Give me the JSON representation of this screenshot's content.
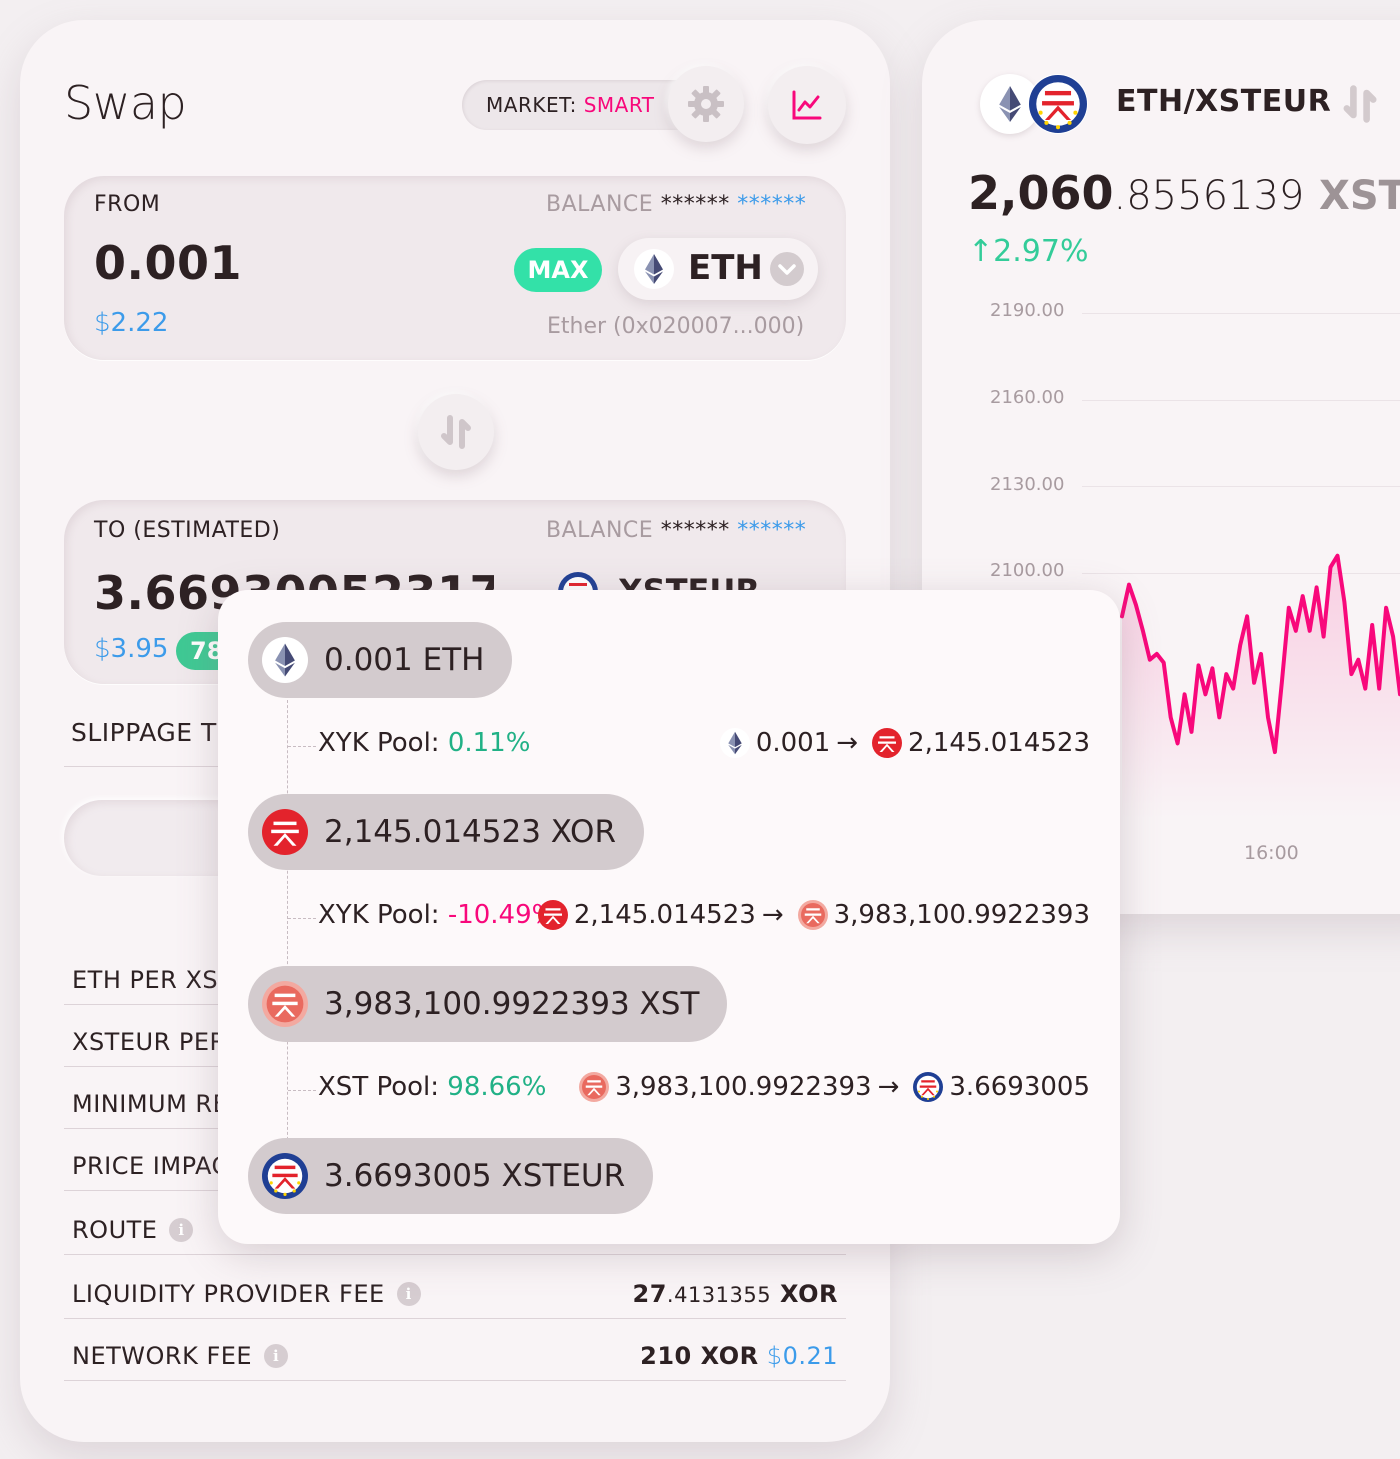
{
  "swap": {
    "title": "Swap",
    "market_label": "MARKET: ",
    "market_value": "SMART",
    "from": {
      "label": "FROM",
      "balance_label": "BALANCE",
      "balance_hidden": "******",
      "balance_hidden_usd": "******",
      "amount": "0.001",
      "usd_symbol": "$",
      "usd_value": "2.22",
      "max_label": "MAX",
      "token": "ETH",
      "token_address": "Ether (0x020007...000)"
    },
    "to": {
      "label": "TO (ESTIMATED)",
      "balance_label": "BALANCE",
      "balance_hidden": "******",
      "balance_hidden_usd": "******",
      "amount": "3.669300523174",
      "usd_symbol": "$",
      "usd_value": "3.95",
      "badge": "78",
      "token": "XSTEUR"
    },
    "slippage_label": "SLIPPAGE T",
    "rows": [
      {
        "label": "ETH PER XST",
        "value": ""
      },
      {
        "label": "XSTEUR PER",
        "value": ""
      },
      {
        "label": "MINIMUM RE",
        "value": ""
      },
      {
        "label": "PRICE IMPAC",
        "value": ""
      },
      {
        "label": "ROUTE",
        "value": ""
      }
    ],
    "lp_fee": {
      "label": "LIQUIDITY PROVIDER FEE",
      "int": "27",
      "dec": ".4131355",
      "unit": "XOR"
    },
    "network_fee": {
      "label": "NETWORK FEE",
      "value": "210 XOR",
      "usd_symbol": "$",
      "usd_value": "0.21"
    }
  },
  "chart": {
    "pair": "ETH/XSTEUR",
    "price_int": "2,060",
    "price_dec": ".8556139",
    "price_unit": "XSTEUR",
    "change_arrow": "↑",
    "change": "2.97%",
    "y_ticks": [
      "2190.00",
      "2160.00",
      "2130.00",
      "2100.00"
    ],
    "x_tick": "16:00",
    "line_color": "#f8087b"
  },
  "chart_data": {
    "type": "line",
    "title": "ETH/XSTEUR",
    "ylim": [
      2040,
      2200
    ],
    "y_ticks": [
      2190,
      2160,
      2130,
      2100
    ],
    "x_ticks": [
      "16:00"
    ],
    "series": [
      {
        "values": [
          2085,
          2096,
          2089,
          2080,
          2070,
          2072,
          2069,
          2050,
          2041,
          2058,
          2045,
          2068,
          2058,
          2067,
          2050,
          2065,
          2060,
          2075,
          2085,
          2062,
          2072,
          2050,
          2038,
          2062,
          2088,
          2080,
          2092,
          2080,
          2095,
          2078,
          2102,
          2106,
          2090,
          2065,
          2070,
          2060,
          2082,
          2060,
          2088,
          2078,
          2058
        ]
      }
    ],
    "grid": true
  },
  "route": {
    "steps": [
      {
        "amount": "0.001 ETH"
      },
      {
        "amount": "2,145.014523 XOR"
      },
      {
        "amount": "3,983,100.9922393 XST"
      },
      {
        "amount": "3.6693005 XSTEUR"
      }
    ],
    "hops": [
      {
        "pool": "XYK Pool: ",
        "pct": "0.11%",
        "from": "0.001",
        "arrow": "→",
        "to": "2,145.014523"
      },
      {
        "pool": "XYK Pool: ",
        "pct": "-10.49%",
        "from": "2,145.014523",
        "arrow": "→",
        "to": "3,983,100.9922393"
      },
      {
        "pool": "XST Pool: ",
        "pct": "98.66%",
        "from": "3,983,100.9922393",
        "arrow": "→",
        "to": "3.6693005"
      }
    ]
  },
  "colors": {
    "accent": "#f8087b",
    "positive": "#33cc99",
    "usd": "#3c9bea",
    "max_button": "#33e1a8"
  },
  "icons": {
    "eth": "eth-icon",
    "xor": "xor-icon",
    "xst": "xst-icon",
    "xsteur": "xsteur-icon",
    "settings": "gear-icon",
    "chart": "line-chart-icon",
    "switch": "swap-arrows-icon",
    "info": "info-icon"
  }
}
